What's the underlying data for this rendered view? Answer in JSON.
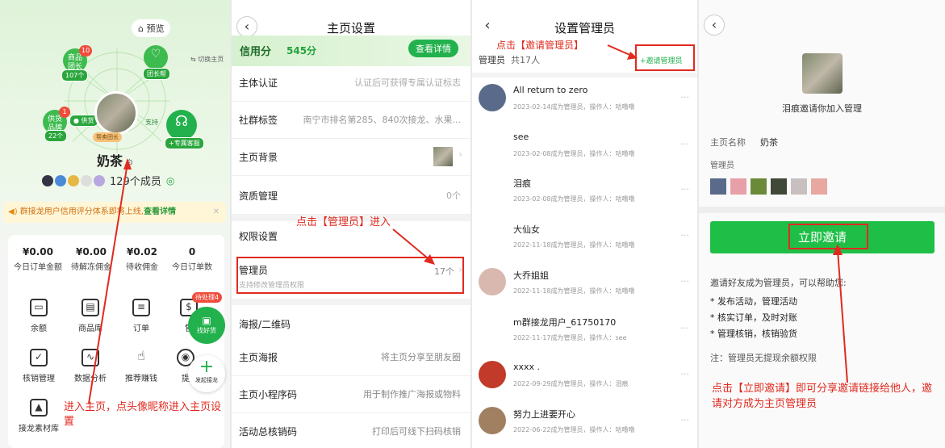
{
  "panel1": {
    "preview": "预览",
    "switch_home": "切换主页",
    "nodes": {
      "mall": {
        "line1": "商品",
        "line2": "团长",
        "count": "107个",
        "badge": "10"
      },
      "help": {
        "label": "团长帮"
      },
      "brand": {
        "line1": "供货",
        "line2": "品牌",
        "count": "22个",
        "badge": "1"
      },
      "supply_left": "供货",
      "support_right": "支持",
      "service": {
        "label": "专属客服"
      }
    },
    "role_tag": "帮卖团长",
    "nickname": "奶茶",
    "members": "129个成员",
    "notice": "群接龙用户信用评分体系即将上线,",
    "notice_link": "查看详情",
    "stats": [
      {
        "value": "¥0.00",
        "label": "今日订单金额"
      },
      {
        "value": "¥0.00",
        "label": "待解冻佣金"
      },
      {
        "value": "¥0.02",
        "label": "待收佣金"
      },
      {
        "value": "0",
        "label": "今日订单数"
      }
    ],
    "grid": [
      {
        "label": "余额",
        "icon": "wallet-icon"
      },
      {
        "label": "商品库",
        "icon": "box-icon"
      },
      {
        "label": "订单",
        "icon": "order-icon"
      },
      {
        "label": "售",
        "icon": "shield-icon"
      },
      {
        "label": "核销管理",
        "icon": "check-icon"
      },
      {
        "label": "数据分析",
        "icon": "chart-icon"
      },
      {
        "label": "推荐赚钱",
        "icon": "thumb-icon"
      },
      {
        "label": "提",
        "icon": "pin-icon"
      },
      {
        "label": "接龙素材库",
        "icon": "image-icon"
      }
    ],
    "pending_badge": "待处理4",
    "find_goods": "找好货",
    "start_chain": "发起接龙",
    "annotation": "进入主页，点头像昵称进入主页设置"
  },
  "panel2": {
    "title": "主页设置",
    "credit_label": "信用分",
    "credit_value": "545分",
    "credit_btn": "查看详情",
    "rows": [
      {
        "title": "主体认证",
        "value": "认证后可获得专属认证标志"
      },
      {
        "title": "社群标签",
        "value": "南宁市排名第285、840次接龙、水果..."
      },
      {
        "title": "主页背景",
        "value": ""
      },
      {
        "title": "资质管理",
        "value": "0个"
      }
    ],
    "perm_title": "权限设置",
    "annotation": "点击【管理员】进入",
    "admin_title": "管理员",
    "admin_count": "17个",
    "admin_desc": "支持修改管理员权限",
    "poster_section": "海报/二维码",
    "rows2": [
      {
        "title": "主页海报",
        "value": "将主页分享至朋友圈"
      },
      {
        "title": "主页小程序码",
        "value": "用于制作推广海报或物料"
      },
      {
        "title": "活动总核销码",
        "value": "打印后可线下扫码核销"
      }
    ]
  },
  "panel3": {
    "title": "设置管理员",
    "annotation": "点击【邀请管理员】",
    "list_label": "管理员",
    "total": "共17人",
    "invite": "+邀请管理员",
    "members": [
      {
        "name": "All return to zero",
        "sub": "2023-02-14成为管理员，操作人：咕噜噜",
        "color": "#5a6a8a"
      },
      {
        "name": "see",
        "sub": "2023-02-08成为管理员，操作人：咕噜噜",
        "color": ""
      },
      {
        "name": "泪痕",
        "sub": "2023-02-08成为管理员，操作人：咕噜噜",
        "color": ""
      },
      {
        "name": "大仙女",
        "sub": "2022-11-18成为管理员，操作人：咕噜噜",
        "color": ""
      },
      {
        "name": "大乔姐姐",
        "sub": "2022-11-18成为管理员，操作人：咕噜噜",
        "color": "#d9b8b0"
      },
      {
        "name": "m群接龙用户_61750170",
        "sub": "2022-11-17成为管理员，操作人：see",
        "color": ""
      },
      {
        "name": "xxxx .",
        "sub": "2022-09-29成为管理员，操作人：泪痕",
        "color": "#c23a2a"
      },
      {
        "name": "努力上进要开心",
        "sub": "2022-06-22成为管理员，操作人：咕噜噜",
        "color": "#a08060"
      }
    ],
    "more": "···"
  },
  "panel4": {
    "invite_text": "泪痕邀请你加入管理",
    "home_name_label": "主页名称",
    "home_name": "奶茶",
    "admin_label": "管理员",
    "btn": "立即邀请",
    "help_title": "邀请好友成为管理员，可以帮助您:",
    "bullets": [
      "* 发布活动，管理活动",
      "* 核实订单，及时对账",
      "* 管理核销，核销验货"
    ],
    "note": "注：管理员无提现余额权限",
    "annotation": "点击【立即邀请】即可分享邀请链接给他人，邀请对方成为主页管理员"
  }
}
